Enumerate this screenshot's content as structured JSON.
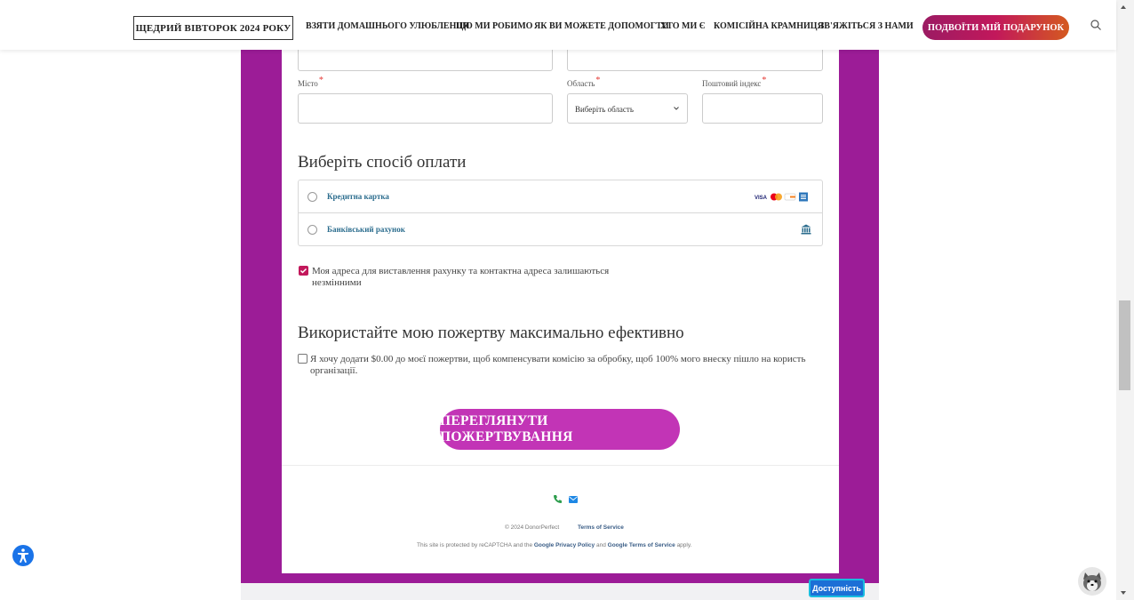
{
  "header": {
    "giving_tuesday": "ЩЕДРИЙ ВІВТОРОК 2024 РОКУ",
    "nav": [
      "ВЗЯТИ ДОМАШНЬОГО УЛЮБЛЕНЦЯ",
      "ЩО МИ РОБИМО",
      "ЯК ВИ МОЖЕТЕ ДОПОМОГТИ",
      "ХТО МИ Є",
      "КОМІСІЙНА КРАМНИЦЯ",
      "ЗВ'ЯЖІТЬСЯ З НАМИ"
    ],
    "double_gift": "ПОДВОЇТИ МІЙ ПОДАРУНОК",
    "search_icon": "search-icon"
  },
  "form": {
    "city_label": "Місто",
    "region_label": "Область",
    "region_value": "Виберіть область",
    "postal_label": "Поштовий індекс",
    "required_mark": "*"
  },
  "payment": {
    "heading": "Виберіть спосіб оплати",
    "options": [
      "Кредитна картка",
      "Банківський рахунок"
    ],
    "card_icons": [
      "visa-icon",
      "mastercard-icon",
      "discover-icon",
      "amex-icon"
    ],
    "bank_icon": "bank-icon",
    "card_brand_text": "VISA"
  },
  "address_same": {
    "checked": true,
    "text": "Моя адреса для виставлення рахунку та контактна адреса залишаються незмінними"
  },
  "maximize": {
    "heading": "Використайте мою пожертву максимально ефективно",
    "checked": false,
    "text": "Я хочу додати $0.00 до моєї пожертви, щоб компенсувати комісію за обробку, щоб 100% мого внеску пішло на користь організації."
  },
  "review_button": "ПЕРЕГЛЯНУТИ ПОЖЕРТВУВАННЯ",
  "footer": {
    "copyright": "© 2024 DonorPerfect",
    "terms": "Terms of Service",
    "recaptcha_prefix": "This site is protected by reCAPTCHA and the",
    "privacy_policy": "Google Privacy Policy",
    "and": "and",
    "google_terms": "Google Terms of Service",
    "apply": "apply."
  },
  "accessibility_button": "Доступність",
  "colors": {
    "purple_frame": "#9c1c97",
    "button_magenta": "#c234b6",
    "link_blue": "#2c6d8e"
  }
}
